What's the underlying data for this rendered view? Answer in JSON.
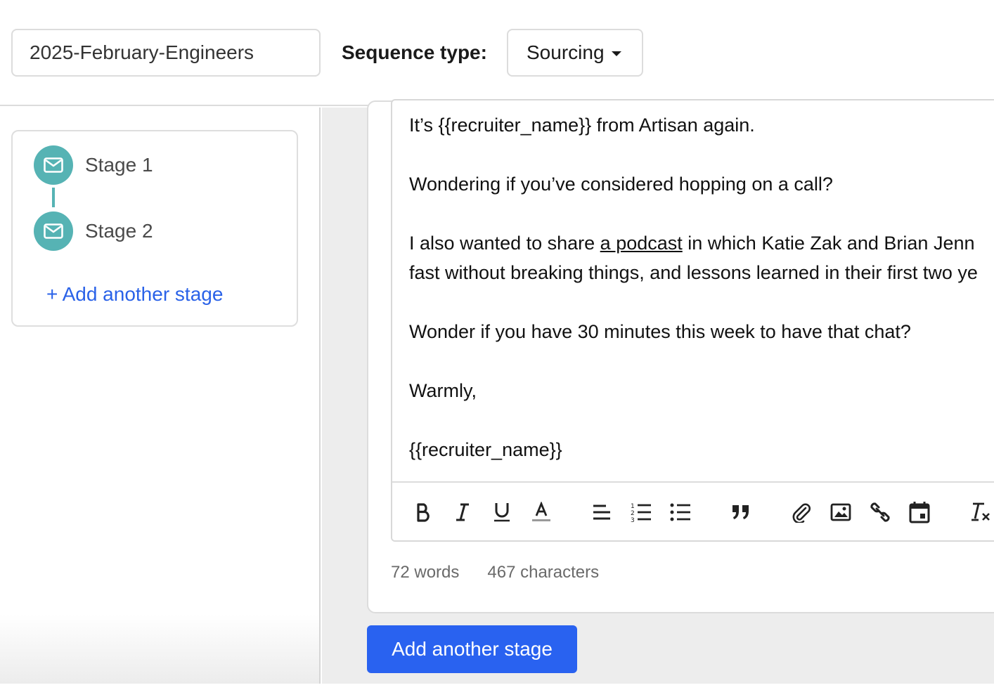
{
  "header": {
    "sequence_name": "2025-February-Engineers",
    "sequence_type_label": "Sequence type:",
    "sequence_type_value": "Sourcing"
  },
  "sidebar": {
    "stages": [
      {
        "label": "Stage 1",
        "icon": "mail-icon"
      },
      {
        "label": "Stage 2",
        "icon": "mail-icon"
      }
    ],
    "add_stage_link": "+ Add another stage"
  },
  "editor": {
    "lines": {
      "l1": "It’s {{recruiter_name}} from Artisan again.",
      "l2": "Wondering if you’ve considered hopping on a call?",
      "l3_pre": "I also wanted to share ",
      "l3_link": "a podcast",
      "l3_post": " in which Katie Zak and Brian Jenn",
      "l4": "fast without breaking things, and lessons learned in their first two ye",
      "l5": "Wonder if you have 30 minutes this week to have that chat?",
      "l6": "Warmly,",
      "l7": "{{recruiter_name}}"
    },
    "toolbar_icons": [
      "bold-icon",
      "italic-icon",
      "underline-icon",
      "text-color-icon",
      "align-left-icon",
      "numbered-list-icon",
      "bulleted-list-icon",
      "quote-icon",
      "attachment-icon",
      "image-icon",
      "link-icon",
      "calendar-icon",
      "clear-format-icon"
    ],
    "word_count": "72 words",
    "char_count": "467 characters"
  },
  "actions": {
    "add_stage_button": "Add another stage"
  },
  "colors": {
    "accent": "#2962f0",
    "stage_teal": "#56b3b4",
    "link_blue": "#2a62e8"
  }
}
